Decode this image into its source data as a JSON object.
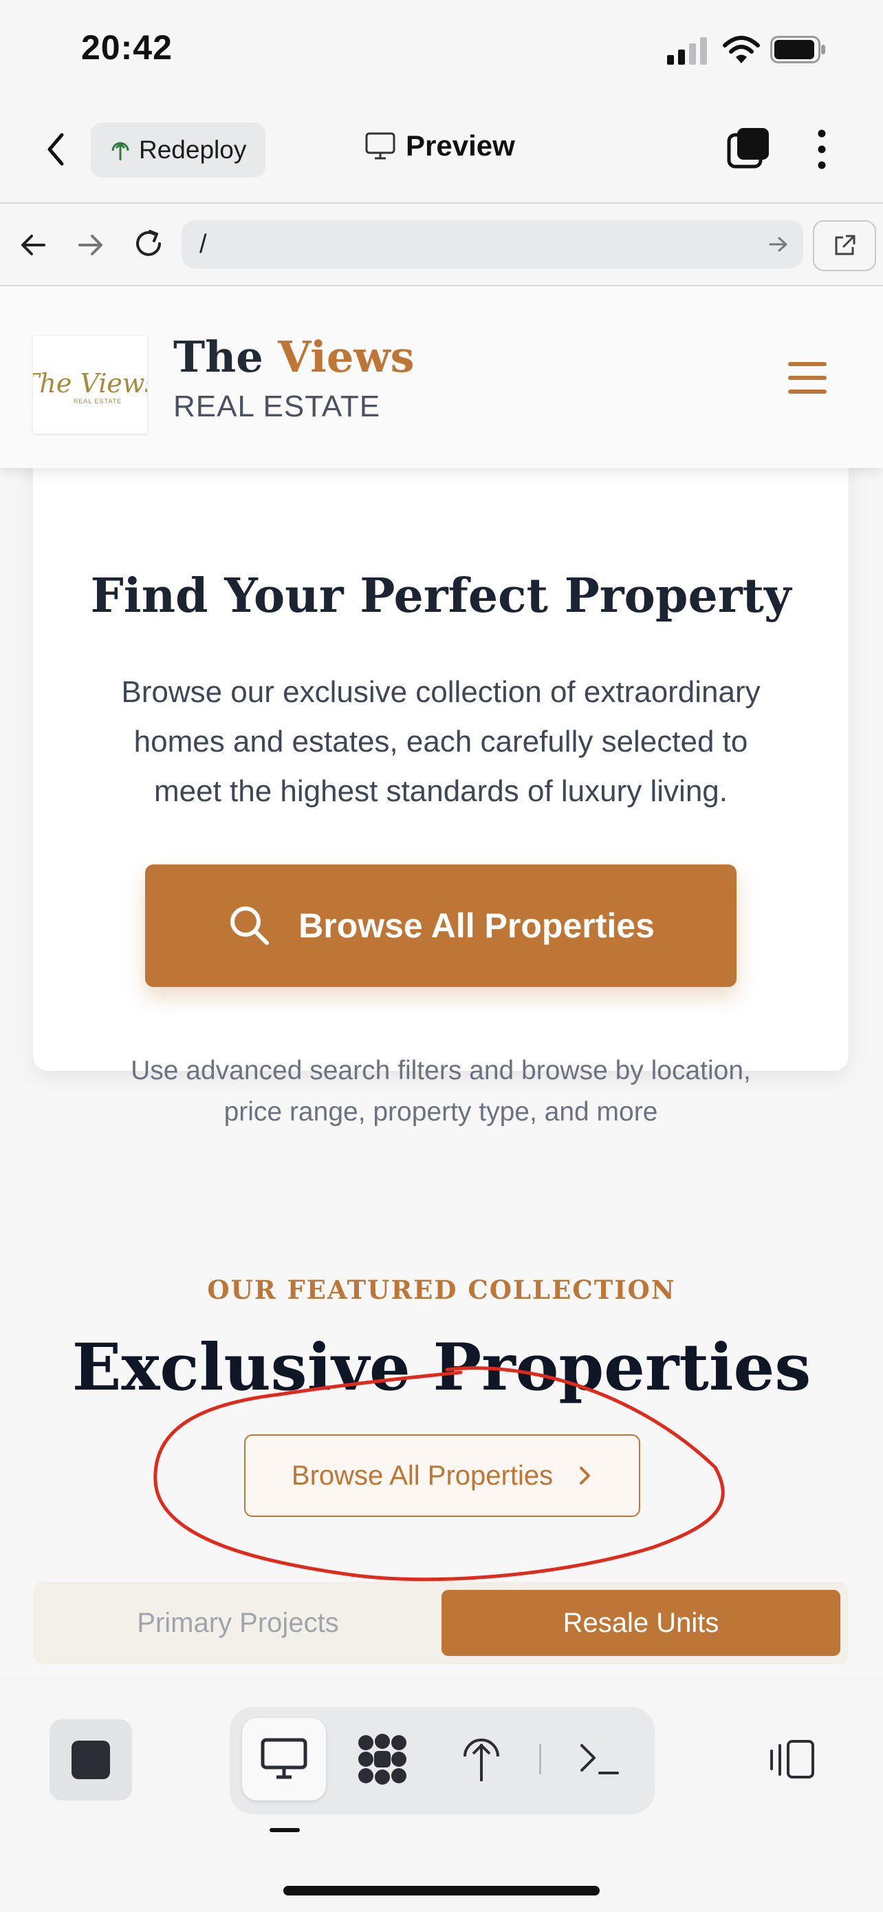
{
  "status_bar": {
    "time": "20:42"
  },
  "app_header": {
    "redeploy_label": "Redeploy",
    "preview_label": "Preview"
  },
  "browser_bar": {
    "url": "/"
  },
  "site_header": {
    "brand_prefix": "The",
    "brand_accent": "Views",
    "brand_sub": "REAL ESTATE",
    "logo_script": "The Views",
    "logo_small": "REAL ESTATE"
  },
  "hero_card": {
    "title": "Find Your Perfect Property",
    "description": "Browse our exclusive collection of extraordinary homes and estates, each carefully selected to meet the highest standards of luxury living.",
    "button_label": "Browse All Properties",
    "note": "Use advanced search filters and browse by location, price range, property type, and more"
  },
  "featured": {
    "kicker": "OUR FEATURED COLLECTION",
    "title": "Exclusive Properties",
    "browse_label": "Browse All Properties",
    "tabs": [
      "Primary Projects",
      "Resale Units"
    ],
    "active_tab": "Resale Units"
  },
  "colors": {
    "accent": "#bd7636",
    "annotation": "#e02a1c",
    "dark": "#0f1626"
  },
  "icons": [
    "back-icon",
    "redeploy-icon",
    "monitor-icon",
    "tabs-icon",
    "more-icon",
    "nav-back-icon",
    "nav-forward-icon",
    "reload-icon",
    "go-arrow-icon",
    "open-external-icon",
    "menu-icon",
    "search-icon",
    "chevron-right-icon",
    "stop-icon",
    "desktop-icon",
    "grid-icon",
    "deploy-icon",
    "terminal-icon",
    "device-icon",
    "signal-icon",
    "wifi-icon",
    "battery-icon"
  ]
}
